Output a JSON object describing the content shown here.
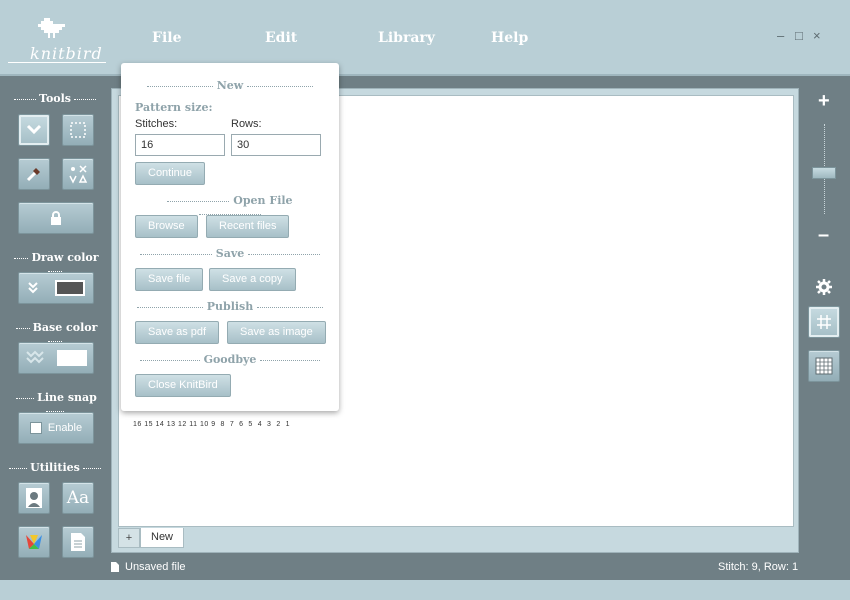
{
  "header": {
    "logo_text": "knitbird",
    "menu": [
      "File",
      "Edit",
      "Library",
      "Help"
    ],
    "window_controls": {
      "minimize": "–",
      "maximize": "□",
      "close": "×"
    }
  },
  "sidebar": {
    "tools_title": "Tools",
    "draw_color_title": "Draw color",
    "base_color_title": "Base color",
    "line_snap_title": "Line snap",
    "line_snap_label": "Enable",
    "utilities_title": "Utilities",
    "draw_color_value": "#555555",
    "base_color_value": "#ffffff",
    "utility_font_label": "Aa"
  },
  "right_sidebar": {
    "zoom_in": "+",
    "zoom_out": "–",
    "zoom_level": 0.45
  },
  "canvas": {
    "stitch_numbers": [
      "16",
      "15",
      "14",
      "13",
      "12",
      "11",
      "10",
      "9",
      "8",
      "7",
      "6",
      "5",
      "4",
      "3",
      "2",
      "1"
    ],
    "tab_add": "+",
    "tab_label": "New"
  },
  "status": {
    "file": "Unsaved file",
    "position": "Stitch: 9, Row: 1"
  },
  "file_menu": {
    "new_title": "New",
    "pattern_size_label": "Pattern size:",
    "stitches_label": "Stitches:",
    "rows_label": "Rows:",
    "stitches_value": "16",
    "rows_value": "30",
    "continue_label": "Continue",
    "open_title": "Open File",
    "browse_label": "Browse",
    "recent_label": "Recent files",
    "save_title": "Save",
    "save_file_label": "Save file",
    "save_copy_label": "Save a copy",
    "publish_title": "Publish",
    "save_pdf_label": "Save as pdf",
    "save_image_label": "Save as image",
    "goodbye_title": "Goodbye",
    "close_label": "Close KnitBird"
  }
}
